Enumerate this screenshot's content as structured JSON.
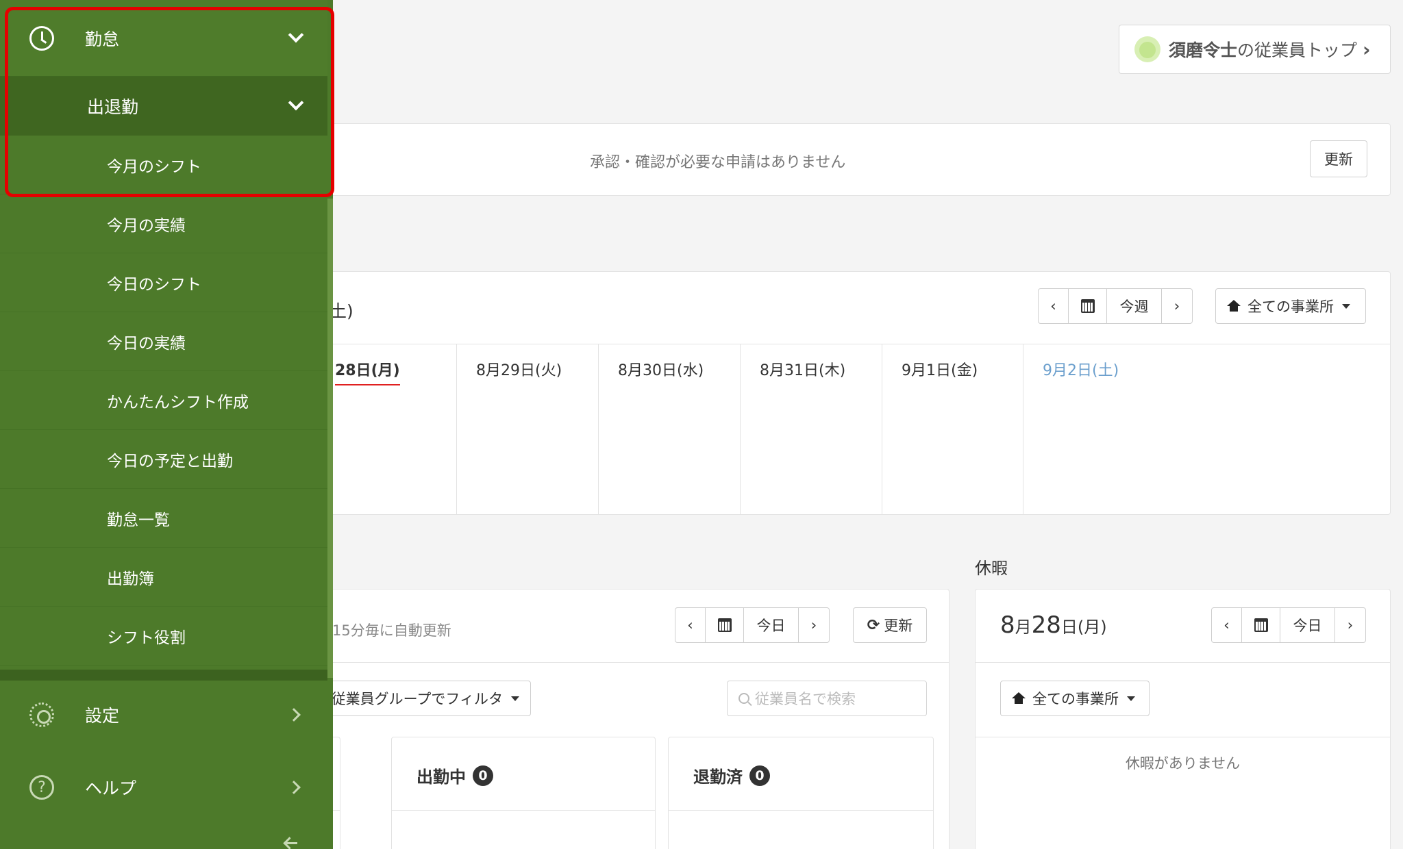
{
  "header": {
    "employee_name": "須磨令士",
    "employee_suffix": "の従業員トップ",
    "chevron": "›"
  },
  "approval": {
    "message": "承認・確認が必要な申請はありません",
    "refresh_label": "更新"
  },
  "week": {
    "range_fragment": "土)",
    "prev": "‹",
    "next": "›",
    "this_week": "今週",
    "office_label": "全ての事業所",
    "days": [
      {
        "label": "28日(月)",
        "today": true
      },
      {
        "label": "8月29日(火)"
      },
      {
        "label": "8月30日(水)"
      },
      {
        "label": "8月31日(木)"
      },
      {
        "label": "9月1日(金)"
      },
      {
        "label": "9月2日(土)",
        "saturday": true
      }
    ]
  },
  "attendance": {
    "auto_refresh": "15分毎に自動更新",
    "today_label": "今日",
    "refresh_label": "更新",
    "filter_label": "従業員グループでフィルタ",
    "search_placeholder": "従業員名で検索",
    "cards": [
      {
        "title": "出勤中",
        "count": "0"
      },
      {
        "title": "退勤済",
        "count": "0"
      }
    ]
  },
  "vacation": {
    "title": "休暇",
    "date_month": "8",
    "date_month_unit": "月",
    "date_day": "28",
    "date_day_unit": "日(月)",
    "today_label": "今日",
    "office_label": "全ての事業所",
    "empty_message": "休暇がありません"
  },
  "sidebar": {
    "section_label": "勤怠",
    "subsection_label": "出退勤",
    "items": [
      {
        "label": "今月のシフト"
      },
      {
        "label": "今月の実績"
      },
      {
        "label": "今日のシフト"
      },
      {
        "label": "今日の実績"
      },
      {
        "label": "かんたんシフト作成"
      },
      {
        "label": "今日の予定と出勤"
      },
      {
        "label": "勤怠一覧"
      },
      {
        "label": "出勤簿"
      },
      {
        "label": "シフト役割"
      }
    ],
    "settings_label": "設定",
    "help_label": "ヘルプ",
    "help_glyph": "?"
  },
  "colors": {
    "sidebar_bg": "#4d7a2a",
    "sidebar_sub_bg": "#3f6620",
    "highlight": "#e50000",
    "today_underline": "#e02020",
    "saturday": "#6b9fcd"
  }
}
